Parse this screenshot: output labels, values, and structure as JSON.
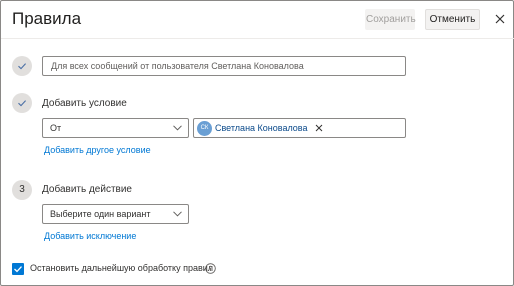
{
  "dialog": {
    "title": "Правила",
    "save_label": "Сохранить",
    "cancel_label": "Отменить"
  },
  "rule_name": {
    "placeholder": "Для всех сообщений от пользователя Светлана Коновалова"
  },
  "condition": {
    "heading": "Добавить условие",
    "field_value": "От",
    "chip_initials": "СК",
    "chip_name": "Светлана Коновалова",
    "add_another_link": "Добавить другое условие"
  },
  "action": {
    "step_number": "3",
    "heading": "Добавить действие",
    "select_value": "Выберите один вариант",
    "add_exception_link": "Добавить исключение"
  },
  "stop_processing": {
    "label": "Остановить дальнейшую обработку правил",
    "checked": true
  },
  "colors": {
    "accent": "#0078d4",
    "chip_avatar": "#6a9fd4",
    "step_circle": "#e1dfdd"
  }
}
